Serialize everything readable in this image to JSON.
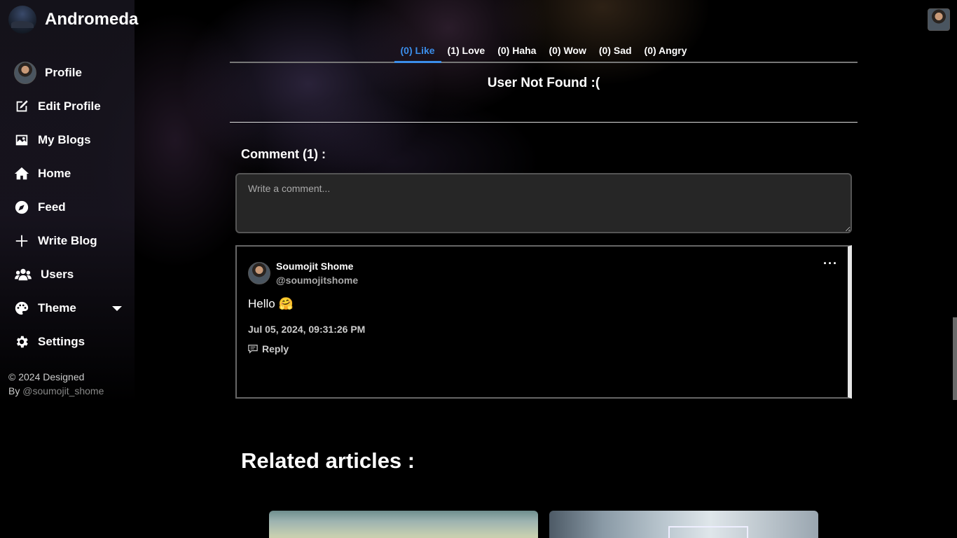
{
  "brand": {
    "name": "Andromeda"
  },
  "sidebar": {
    "items": [
      {
        "label": "Profile",
        "icon": "avatar"
      },
      {
        "label": "Edit Profile",
        "icon": "edit-icon"
      },
      {
        "label": "My Blogs",
        "icon": "image-icon"
      },
      {
        "label": "Home",
        "icon": "home-icon"
      },
      {
        "label": "Feed",
        "icon": "compass-icon"
      },
      {
        "label": "Write Blog",
        "icon": "plus-icon"
      },
      {
        "label": "Users",
        "icon": "users-icon"
      },
      {
        "label": "Theme",
        "icon": "palette-icon"
      },
      {
        "label": "Settings",
        "icon": "gear-icon"
      }
    ],
    "copyright": {
      "line1": "© 2024 Designed",
      "by": "By ",
      "handle": "@soumojit_shome"
    }
  },
  "reactions": {
    "tabs": [
      {
        "label": "(0) Like",
        "active": true
      },
      {
        "label": "(1) Love"
      },
      {
        "label": "(0) Haha"
      },
      {
        "label": "(0) Wow"
      },
      {
        "label": "(0) Sad"
      },
      {
        "label": "(0) Angry"
      }
    ],
    "empty_message": "User Not Found :("
  },
  "comments": {
    "heading": "Comment (1) :",
    "placeholder": "Write a comment...",
    "items": [
      {
        "name": "Soumojit Shome",
        "handle": "@soumojitshome",
        "text": "Hello 🤗",
        "date": "Jul 05, 2024, 09:31:26 PM",
        "reply_label": "Reply",
        "menu": "···"
      }
    ]
  },
  "related": {
    "heading": "Related articles :"
  },
  "colors": {
    "accent": "#3b8eea",
    "background": "#000000",
    "input_bg": "#262626"
  }
}
